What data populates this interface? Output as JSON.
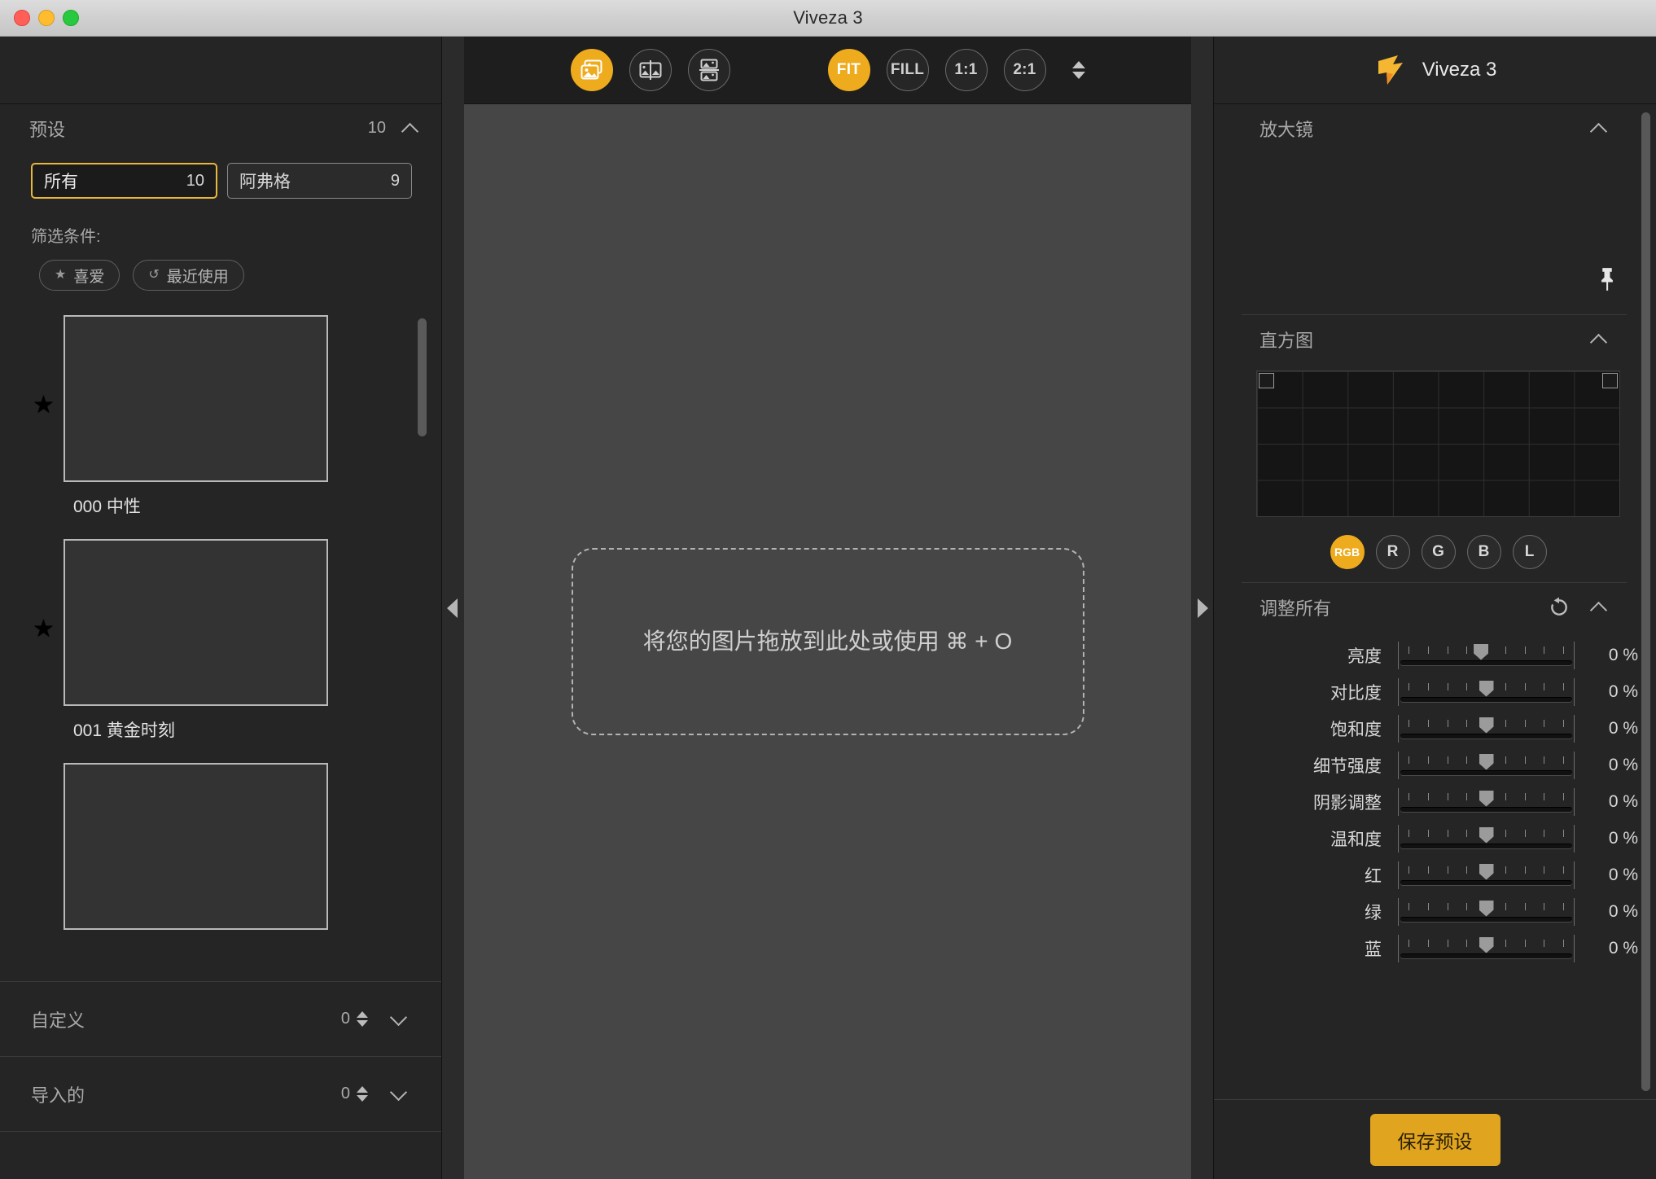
{
  "window": {
    "title": "Viveza 3",
    "controls": [
      "close",
      "minimize",
      "maximize"
    ]
  },
  "left_panel": {
    "presets": {
      "title": "预设",
      "count": "10",
      "collapse_icon": "chevron-up-icon",
      "tabs": [
        {
          "label": "所有",
          "count": "10",
          "selected": true
        },
        {
          "label": "阿弗格",
          "count": "9",
          "selected": false
        }
      ],
      "filter_label": "筛选条件:",
      "chips": [
        {
          "label": "喜爱",
          "icon": "star-icon"
        },
        {
          "label": "最近使用",
          "icon": "history-icon"
        }
      ],
      "items": [
        {
          "name": "000 中性",
          "favorite": true
        },
        {
          "name": "001 黄金时刻",
          "favorite": true
        },
        {
          "name": "",
          "favorite": false
        }
      ]
    },
    "sections": [
      {
        "label": "自定义",
        "count": "0",
        "collapse_icon": "chevron-down-icon"
      },
      {
        "label": "导入的",
        "count": "0",
        "collapse_icon": "chevron-down-icon"
      }
    ]
  },
  "toolbar": {
    "view_modes": [
      {
        "name": "single-image",
        "icon": "stacked-images-icon",
        "active": true
      },
      {
        "name": "side-by-side",
        "icon": "split-vertical-icon",
        "active": false
      },
      {
        "name": "top-bottom",
        "icon": "split-horizontal-icon",
        "active": false
      }
    ],
    "zoom_modes": [
      {
        "label": "FIT",
        "active": true
      },
      {
        "label": "FILL",
        "active": false
      },
      {
        "label": "1:1",
        "active": false
      },
      {
        "label": "2:1",
        "active": false
      }
    ],
    "zoom_stepper_icon": "stepper-up-down-icon"
  },
  "canvas": {
    "dropzone_text": "将您的图片拖放到此处或使用 ⌘ + O",
    "collapse_left_icon": "triangle-left-icon",
    "collapse_right_icon": "triangle-right-icon"
  },
  "right_panel": {
    "brand": {
      "name": "Viveza 3",
      "logo_icon": "viveza-flag-logo-icon"
    },
    "magnifier": {
      "title": "放大镜",
      "collapse_icon": "chevron-up-icon",
      "pin_icon": "pushpin-icon"
    },
    "histogram": {
      "title": "直方图",
      "collapse_icon": "chevron-up-icon",
      "channels": [
        {
          "label": "RGB",
          "active": true
        },
        {
          "label": "R",
          "active": false
        },
        {
          "label": "G",
          "active": false
        },
        {
          "label": "B",
          "active": false
        },
        {
          "label": "L",
          "active": false
        }
      ]
    },
    "adjust": {
      "title": "调整所有",
      "reset_icon": "reset-arrow-icon",
      "collapse_icon": "chevron-up-icon",
      "sliders": [
        {
          "label": "亮度",
          "value": "0 %",
          "pos": 47
        },
        {
          "label": "对比度",
          "value": "0 %",
          "pos": 50
        },
        {
          "label": "饱和度",
          "value": "0 %",
          "pos": 50
        },
        {
          "label": "细节强度",
          "value": "0 %",
          "pos": 50
        },
        {
          "label": "阴影调整",
          "value": "0 %",
          "pos": 50
        },
        {
          "label": "温和度",
          "value": "0 %",
          "pos": 50
        },
        {
          "label": "红",
          "value": "0 %",
          "pos": 50
        },
        {
          "label": "绿",
          "value": "0 %",
          "pos": 50
        },
        {
          "label": "蓝",
          "value": "0 %",
          "pos": 50
        }
      ]
    },
    "save_preset_label": "保存预设"
  },
  "colors": {
    "accent": "#eeab1d",
    "accent_button": "#e0a41f",
    "panel_bg": "#252525",
    "canvas_bg": "#464646",
    "toolbar_bg": "#1e1e1e"
  }
}
